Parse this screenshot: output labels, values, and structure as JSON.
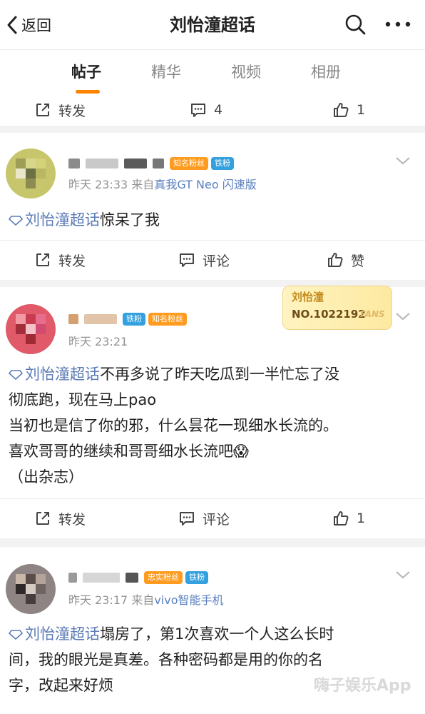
{
  "header": {
    "back_label": "返回",
    "title": "刘怡潼超话"
  },
  "tabs": [
    {
      "label": "帖子",
      "active": true
    },
    {
      "label": "精华",
      "active": false
    },
    {
      "label": "视频",
      "active": false
    },
    {
      "label": "相册",
      "active": false
    }
  ],
  "prev_post": {
    "repost_label": "转发",
    "comment_count": "4",
    "like_count": "1"
  },
  "posts": [
    {
      "badges": [
        "知名粉丝",
        "铁粉"
      ],
      "time": "昨天 23:33",
      "source_prefix": "来自",
      "source": "真我GT Neo 闪速版",
      "topic": "刘怡潼超话",
      "text": "惊呆了我",
      "repost_label": "转发",
      "comment_label": "评论",
      "like_label": "赞"
    },
    {
      "badges": [
        "铁粉",
        "知名粉丝"
      ],
      "fans_card": {
        "name": "刘怡潼",
        "number": "NO.1022192",
        "tag": "FANS"
      },
      "time": "昨天 23:21",
      "topic": "刘怡潼超话",
      "text_line1": "不再多说了昨天吃瓜到一半忙忘了没",
      "text_line2": "彻底跑，现在马上pao",
      "text_line3": "当初也是信了你的邪，什么昙花一现细水长流的。",
      "text_line4": "喜欢哥哥的继续和哥哥细水长流吧😱",
      "text_line5": "（出杂志）",
      "repost_label": "转发",
      "comment_label": "评论",
      "like_count": "1"
    },
    {
      "badges": [
        "忠实粉丝",
        "铁粉"
      ],
      "time": "昨天 23:17",
      "source_prefix": "来自",
      "source": "vivo智能手机",
      "topic": "刘怡潼超话",
      "text_line1": "塌房了，第1次喜欢一个人这么长时",
      "text_line2": "间，我的眼光是真差。各种密码都是用的你的名",
      "text_line3": "字，改起来好烦"
    }
  ],
  "watermark": "嗨子娱乐App",
  "colors": {
    "accent": "#ff8200",
    "topic": "#5b7bb6",
    "iron_badge": "#33a0e0",
    "fan_badge": "#ff9b1f"
  }
}
